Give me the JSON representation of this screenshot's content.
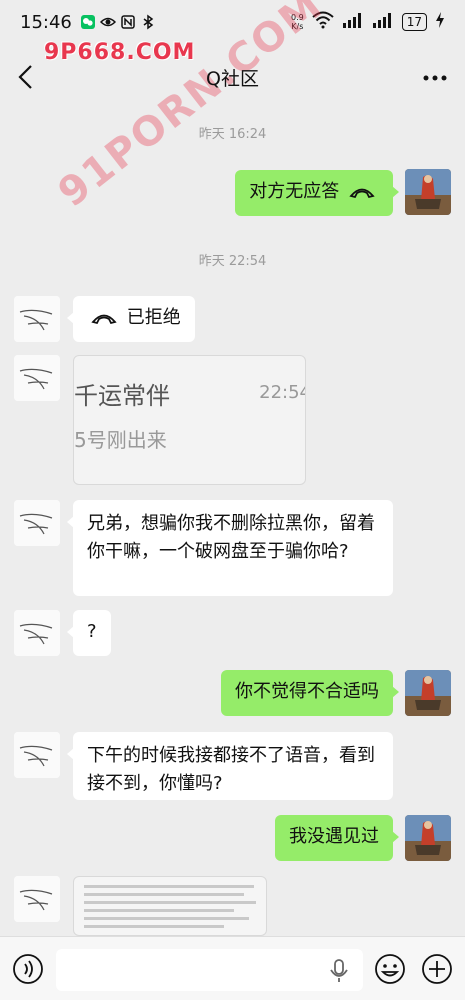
{
  "status": {
    "time": "15:46",
    "net_speed_value": "0.9",
    "net_speed_unit": "K/s",
    "battery": "17"
  },
  "watermark": {
    "top": "9P668.COM",
    "diagonal": "91PORN.COM"
  },
  "nav": {
    "title": "Q社区"
  },
  "messages": {
    "ts1": "昨天 16:24",
    "m1": "对方无应答",
    "ts2": "昨天 22:54",
    "m2": "已拒绝",
    "m3_image_line1": "千运常伴",
    "m3_image_time": "22:54",
    "m3_image_line2": "5号刚出来",
    "m4": "兄弟，想骗你我不删除拉黑你，留着你干嘛，一个破网盘至于骗你哈?",
    "m5": "?",
    "m6": "你不觉得不合适吗",
    "m7": "下午的时候我接都接不了语音，看到接不到，你懂吗?",
    "m8": "我没遇见过"
  },
  "colors": {
    "self_bubble": "#95ec69",
    "other_bubble": "#ffffff",
    "background": "#ededed",
    "watermark": "#e8374e"
  },
  "icons": {
    "back": "chevron-left-icon",
    "more": "more-dots-icon",
    "voice": "voice-icon",
    "mic": "microphone-icon",
    "emoji": "emoji-icon",
    "add": "plus-icon",
    "call": "hang-up-icon"
  }
}
